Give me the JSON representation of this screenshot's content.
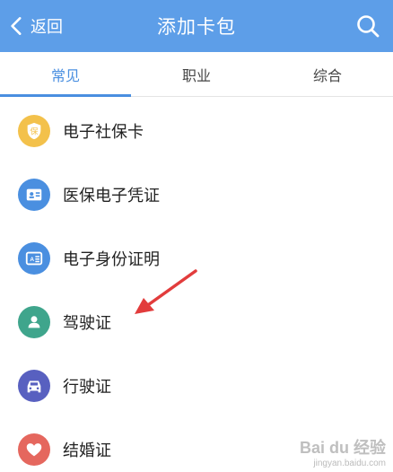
{
  "header": {
    "back_label": "返回",
    "title": "添加卡包",
    "back_icon": "chevron-left-icon",
    "search_icon": "search-icon",
    "color": "#5d9ee8"
  },
  "tabs": [
    {
      "label": "常见",
      "active": true
    },
    {
      "label": "职业",
      "active": false
    },
    {
      "label": "综合",
      "active": false
    }
  ],
  "items": [
    {
      "label": "电子社保卡",
      "icon": "shield-icon",
      "color": "#f3c14b"
    },
    {
      "label": "医保电子凭证",
      "icon": "id-card-icon",
      "color": "#4a8fe0"
    },
    {
      "label": "电子身份证明",
      "icon": "identity-card-icon",
      "color": "#4a8fe0"
    },
    {
      "label": "驾驶证",
      "icon": "person-icon",
      "color": "#3fa58c"
    },
    {
      "label": "行驶证",
      "icon": "car-icon",
      "color": "#5860c0"
    },
    {
      "label": "结婚证",
      "icon": "heart-icon",
      "color": "#e5675e"
    }
  ],
  "annotation": {
    "icon": "red-arrow-icon",
    "color": "#e23c3c"
  },
  "watermark": {
    "main": "Bai du 经验",
    "sub": "jingyan.baidu.com"
  }
}
